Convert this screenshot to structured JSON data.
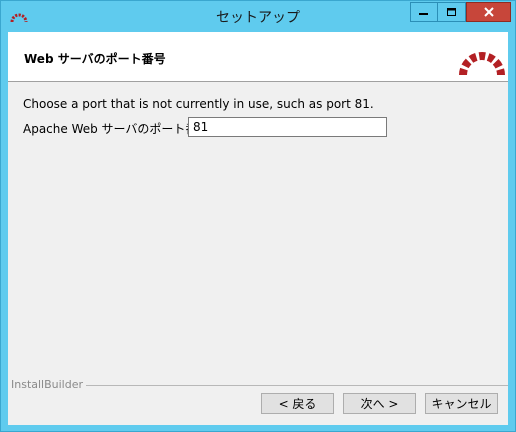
{
  "window": {
    "title": "セットアップ",
    "controls": {
      "minimize": "minimize",
      "maximize": "maximize",
      "close": "close"
    }
  },
  "header": {
    "title": "Web サーバのポート番号",
    "logo": "redmine-logo"
  },
  "content": {
    "description": "Choose a port that is not currently in use, such as port 81.",
    "port_label": "Apache Web サーバのポート番号",
    "port_value": "81"
  },
  "footer": {
    "brand": "InstallBuilder",
    "back_label": "< 戻る",
    "next_label": "次へ >",
    "cancel_label": "キャンセル"
  },
  "colors": {
    "titlebar": "#5fcbee",
    "close_button": "#c7463a",
    "logo": "#b32024"
  }
}
